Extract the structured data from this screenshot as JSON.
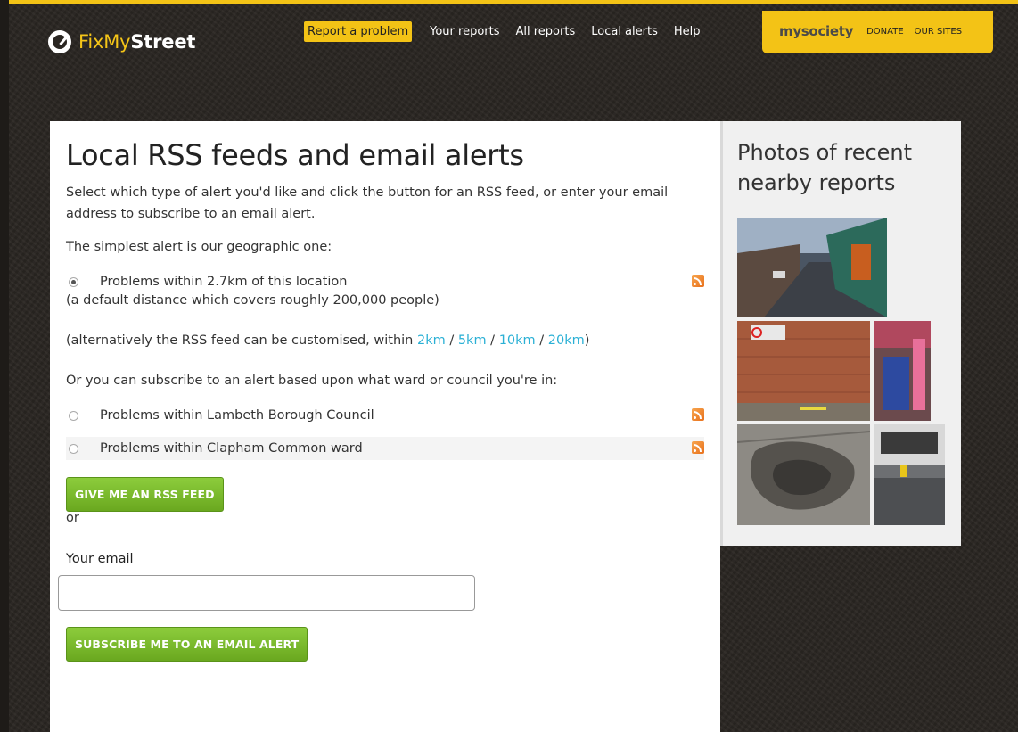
{
  "header": {
    "logo": {
      "part1": "FixMy",
      "part2": "Street"
    },
    "nav": {
      "report": "Report a problem",
      "your_reports": "Your reports",
      "all_reports": "All reports",
      "local_alerts": "Local alerts",
      "help": "Help"
    },
    "mysociety": {
      "brand": "mysociety",
      "donate": "DONATE",
      "our_sites": "OUR SITES"
    }
  },
  "main": {
    "title": "Local RSS feeds and email alerts",
    "intro": "Select which type of alert you'd like and click the button for an RSS feed, or enter your email address to subscribe to an email alert.",
    "simplest": "The simplest alert is our geographic one:",
    "geo_option": "Problems within 2.7km of this location",
    "geo_note": "(a default distance which covers roughly 200,000 people)",
    "custom_prefix": "(alternatively the RSS feed can be customised, within ",
    "distances": [
      "2km",
      "5km",
      "10km",
      "20km"
    ],
    "custom_suffix": ")",
    "ward_intro": "Or you can subscribe to an alert based upon what ward or council you're in:",
    "council_option": "Problems within Lambeth Borough Council",
    "ward_option": "Problems within Clapham Common ward",
    "rss_button": "GIVE ME AN RSS FEED",
    "or": "or",
    "email_label": "Your email",
    "email_value": "",
    "subscribe_button": "SUBSCRIBE ME TO AN EMAIL ALERT"
  },
  "sidebar": {
    "title": "Photos of recent nearby reports"
  },
  "colors": {
    "accent": "#f3c316",
    "link": "#2ab0d5",
    "button": "#77b82a",
    "background": "#2a2622"
  }
}
